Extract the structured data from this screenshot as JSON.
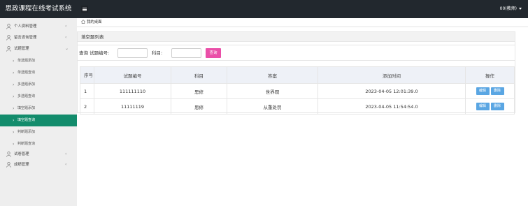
{
  "app": {
    "title": "思政课程在线考试系统",
    "user_label": "00(教师)"
  },
  "sidebar": {
    "items": [
      {
        "label": "个人资料管理",
        "icon": "user-icon"
      },
      {
        "label": "留言咨询管理",
        "icon": "user-icon"
      },
      {
        "label": "试题管理",
        "icon": "user-icon",
        "expanded": true
      }
    ],
    "sub_items": [
      {
        "label": "单选题添加"
      },
      {
        "label": "单选题查询"
      },
      {
        "label": "多选题添加"
      },
      {
        "label": "多选题查询"
      },
      {
        "label": "填空题添加"
      },
      {
        "label": "填空题查询",
        "active": true
      },
      {
        "label": "判断题添加"
      },
      {
        "label": "判断题查询"
      }
    ],
    "items_after": [
      {
        "label": "试卷管理",
        "icon": "user-icon"
      },
      {
        "label": "成绩管理",
        "icon": "user-icon"
      }
    ]
  },
  "tabs": [
    {
      "label": "我的桌面",
      "icon": "home-icon"
    }
  ],
  "panel": {
    "title": "填空题列表"
  },
  "search": {
    "query_label": "查询 试题编号:",
    "query_value": "",
    "subject_label": "科目:",
    "subject_value": "",
    "button_label": "查询"
  },
  "table": {
    "headers": {
      "seq": "序号",
      "code": "试题编号",
      "subject": "科目",
      "answer": "答案",
      "time": "添加时间",
      "ops": "操作"
    },
    "rows": [
      {
        "seq": "1",
        "code": "111111110",
        "subject": "思修",
        "answer": "世界观",
        "time": "2023-04-05 12:01:39.0",
        "edit": "编辑",
        "delete": "删除"
      },
      {
        "seq": "2",
        "code": "11111119",
        "subject": "思修",
        "answer": "从重处罚",
        "time": "2023-04-05 11:54:54.0",
        "edit": "编辑",
        "delete": "删除"
      }
    ]
  },
  "colors": {
    "topbar": "#22282e",
    "sidebar": "#eeeeee",
    "active": "#138c6c",
    "search_button": "#ea4fa8",
    "action_button": "#5aa6e3"
  }
}
